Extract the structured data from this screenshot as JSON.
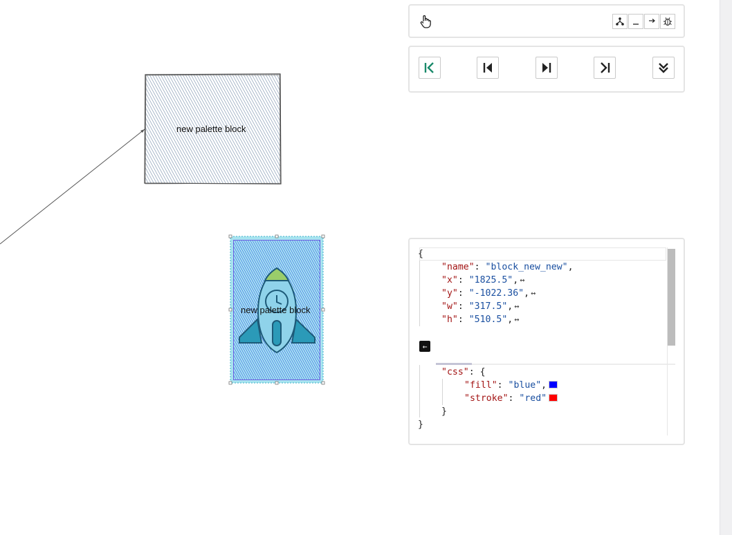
{
  "canvas": {
    "block1": {
      "label": "new palette block",
      "fill": "#4a6a8f",
      "stroke": "#444444"
    },
    "block2": {
      "label": "new palette block",
      "fill": "#2b55e6",
      "stroke": "#3b6be0",
      "background": "#a8e4f0",
      "icon": "rocket-icon"
    },
    "connector": {
      "color": "#555555"
    }
  },
  "toolbar": {
    "select_tool_icon": "hand-pointer-icon",
    "mini_buttons": [
      "hierarchy-icon",
      "minimize-icon",
      "arrow-right-icon",
      "bug-icon"
    ]
  },
  "navigator": {
    "buttons": [
      "go-first-icon",
      "step-back-icon",
      "step-forward-icon",
      "go-last-icon",
      "expand-all-icon"
    ],
    "accent": "#1a8a6a"
  },
  "editor": {
    "open_brace": "{",
    "close_brace": "}",
    "name_key": "\"name\"",
    "name_value": "\"block_new_new\"",
    "x_key": "\"x\"",
    "x_value": "\"1825.5\"",
    "y_key": "\"y\"",
    "y_value": "\"-1022.36\"",
    "w_key": "\"w\"",
    "w_value": "\"317.5\"",
    "h_key": "\"h\"",
    "h_value": "\"510.5\"",
    "css_key": "\"css\"",
    "css_open": "{",
    "css_close": "}",
    "fill_key": "\"fill\"",
    "fill_value": "\"blue\"",
    "fill_color": "#0000ff",
    "stroke_key": "\"stroke\"",
    "stroke_value": "\"red\"",
    "stroke_color": "#ff0000",
    "drag_glyph": "↔",
    "fold_glyph": "←"
  }
}
